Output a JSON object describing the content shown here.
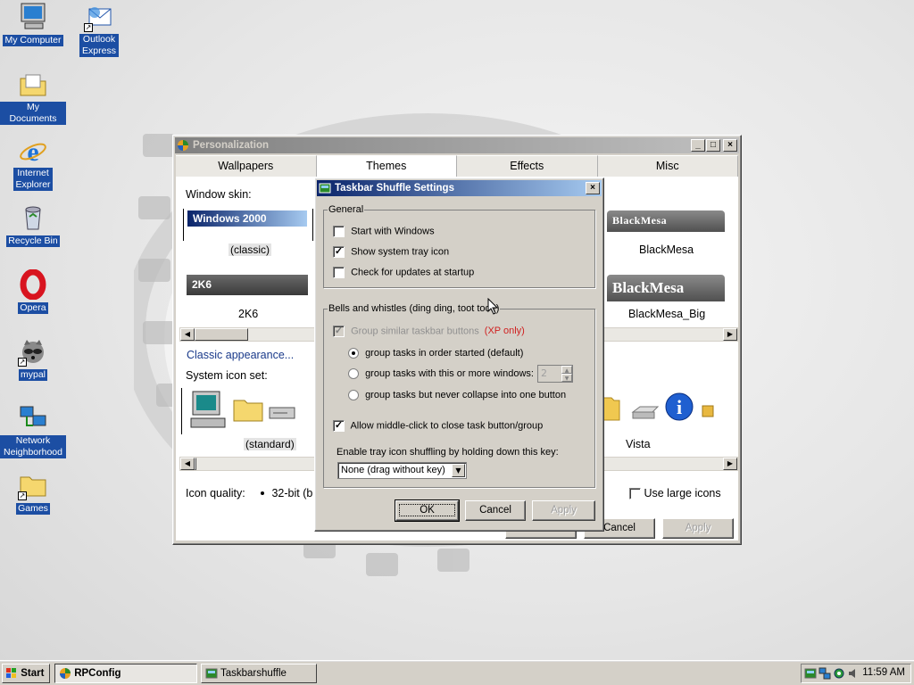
{
  "desktop": {
    "icons": [
      {
        "label": "My Computer"
      },
      {
        "label": "Outlook Express"
      },
      {
        "label": "My Documents"
      },
      {
        "label": "Internet Explorer"
      },
      {
        "label": "Recycle Bin"
      },
      {
        "label": "Opera"
      },
      {
        "label": "mypal"
      },
      {
        "label": "Network Neighborhood"
      },
      {
        "label": "Games"
      }
    ]
  },
  "personalization": {
    "title": "Personalization",
    "tabs": [
      "Wallpapers",
      "Themes",
      "Effects",
      "Misc"
    ],
    "selected_tab": "Themes",
    "window_skin_label": "Window skin:",
    "skins": [
      {
        "bar": "Windows 2000",
        "name": "(classic)"
      },
      {
        "bar": "2K6",
        "name": "2K6"
      },
      {
        "bar": "BlackMesa",
        "name": "BlackMesa"
      },
      {
        "bar": "BlackMesa",
        "name": "BlackMesa_Big"
      }
    ],
    "classic_appearance_link": "Classic appearance...",
    "system_icon_set_label": "System icon set:",
    "icon_sets": [
      {
        "name": "(standard)"
      },
      {
        "name": "Vista"
      }
    ],
    "icon_quality_label": "Icon quality:",
    "icon_quality_option": "32-bit (b",
    "use_large_icons_label": "Use large icons",
    "use_large_icons_checked": false,
    "buttons": {
      "cancel": "Cancel",
      "apply": "Apply"
    }
  },
  "dialog": {
    "title": "Taskbar Shuffle Settings",
    "general": {
      "legend": "General",
      "options": [
        {
          "label": "Start with Windows",
          "checked": false
        },
        {
          "label": "Show system tray icon",
          "checked": true
        },
        {
          "label": "Check for updates at startup",
          "checked": false
        }
      ]
    },
    "bells": {
      "legend": "Bells and whistles (ding ding, toot toot!)",
      "group_similar_label": "Group similar taskbar buttons",
      "group_similar_note": "(XP only)",
      "group_similar_checked": true,
      "radio_options": [
        {
          "label": "group tasks in order started (default)",
          "selected": true
        },
        {
          "label": "group tasks with this or more windows:",
          "selected": false
        },
        {
          "label": "group tasks but never collapse into one button",
          "selected": false
        }
      ],
      "window_count_value": "2",
      "middle_click_label": "Allow middle-click to close task button/group",
      "middle_click_checked": true,
      "tray_shuffle_label": "Enable tray icon shuffling by holding down this key:",
      "tray_shuffle_value": "None (drag without key)"
    },
    "buttons": {
      "ok": "OK",
      "cancel": "Cancel",
      "apply": "Apply"
    }
  },
  "taskbar": {
    "start_label": "Start",
    "tasks": [
      {
        "label": "RPConfig",
        "active": true
      },
      {
        "label": "Taskbarshuffle",
        "active": false
      }
    ],
    "clock": "11:59 AM"
  },
  "colors": {
    "desktop_label_bg": "#1c4ea3",
    "active_title": "#0a246a",
    "inactive_title": "#808080",
    "xp_only_note": "#d02020"
  }
}
